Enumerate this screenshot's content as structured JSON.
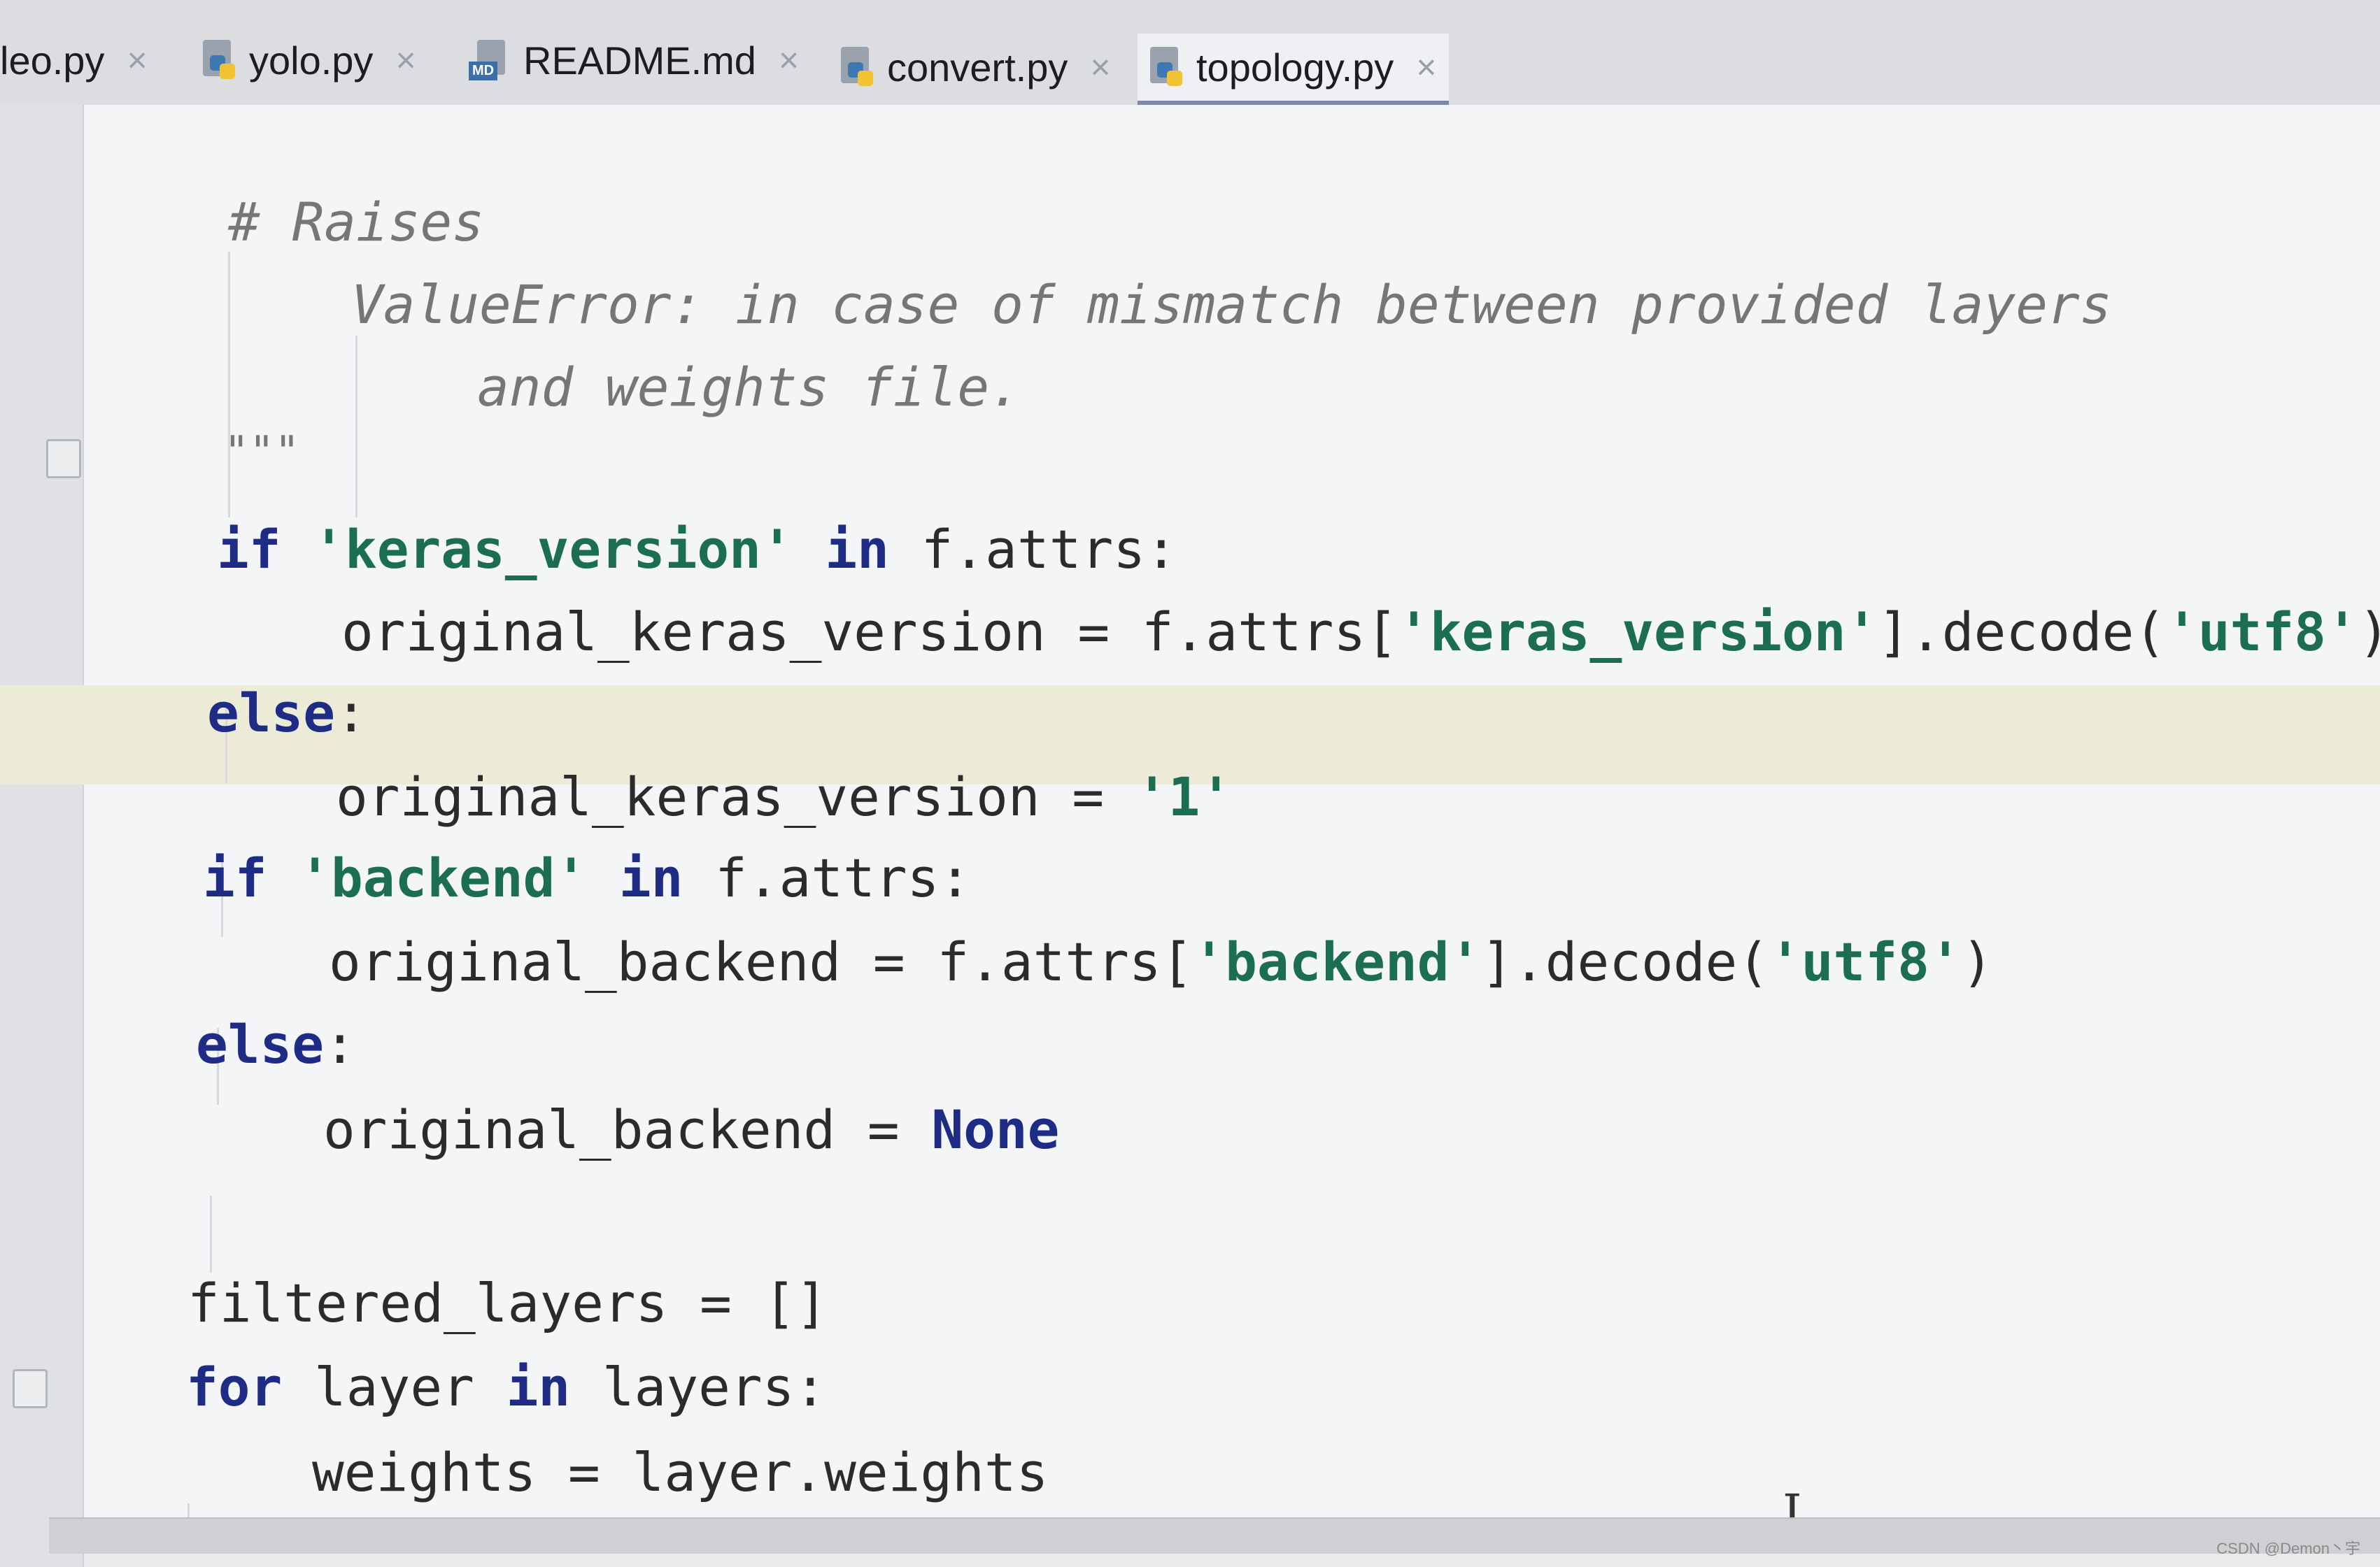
{
  "tabs": [
    {
      "label": "leo.py",
      "icon": "python-file-icon",
      "close": "×"
    },
    {
      "label": "yolo.py",
      "icon": "python-file-icon",
      "close": "×"
    },
    {
      "label": "README.md",
      "icon": "markdown-file-icon",
      "icon_text": "MD",
      "close": "×"
    },
    {
      "label": "convert.py",
      "icon": "python-file-icon",
      "close": "×"
    },
    {
      "label": "topology.py",
      "icon": "python-file-icon",
      "close": "×",
      "active": true
    }
  ],
  "code": {
    "l1": "# Raises",
    "l2": "ValueError: in case of mismatch between provided layers",
    "l3": "and weights file.",
    "l4": "\"\"\"",
    "l5_kw": "if",
    "l5_str": "'keras_version'",
    "l5_kw2": "in",
    "l5_rest": "f.attrs:",
    "l6_a": "original_keras_version = f.attrs[",
    "l6_str": "'keras_version'",
    "l6_b": "].decode(",
    "l6_str2": "'utf8'",
    "l6_c": ")",
    "l7_kw": "else",
    "l7_rest": ":",
    "l8_a": "original_keras_version = ",
    "l8_str": "'1'",
    "l9_kw": "if",
    "l9_str": "'backend'",
    "l9_kw2": "in",
    "l9_rest": "f.attrs:",
    "l10_a": "original_backend = f.attrs[",
    "l10_str": "'backend'",
    "l10_b": "].decode(",
    "l10_str2": "'utf8'",
    "l10_c": ")",
    "l11_kw": "else",
    "l11_rest": ":",
    "l12_a": "original_backend = ",
    "l12_none": "None",
    "l13": "filtered_layers = []",
    "l14_kw": "for",
    "l14_a": "layer",
    "l14_kw2": "in",
    "l14_b": "layers:",
    "l15": "weights = layer.weights"
  },
  "caret_glyph": "I",
  "watermark": "CSDN @Demon丶宇"
}
